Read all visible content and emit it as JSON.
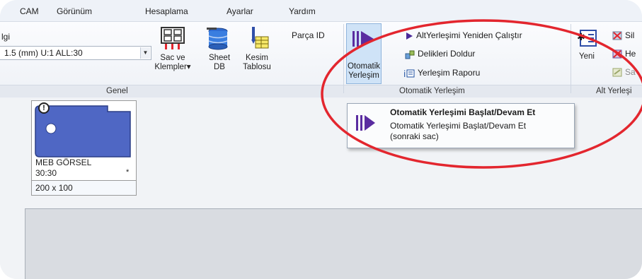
{
  "menu": {
    "items": [
      "CAM",
      "Görünüm",
      "Hesaplama",
      "Ayarlar",
      "Yardım"
    ]
  },
  "ribbon": {
    "genel": {
      "cut_label": "lgi",
      "combo_value": "1.5 (mm)  U:1 ALL:30",
      "sac_klemp_line1": "Sac ve",
      "sac_klemp_line2": "Klempler",
      "sheet_db_line1": "Sheet",
      "sheet_db_line2": "DB",
      "kesim_line1": "Kesim",
      "kesim_line2": "Tablosu",
      "parca_id": "Parça ID",
      "group_label": "Genel"
    },
    "otomatik": {
      "button_line1": "Otomatik",
      "button_line2": "Yerleşim",
      "cmd_restart": "AltYerleşimi Yeniden Çalıştır",
      "cmd_fill": "Delikleri Doldur",
      "cmd_report": "Yerleşim Raporu",
      "group_label": "Otomatik Yerleşim"
    },
    "alt": {
      "new_label": "Yeni",
      "cmd_1": "Sil",
      "cmd_2": "He",
      "cmd_3": "Sa",
      "group_label": "Alt Yerleşi"
    }
  },
  "dropdown": {
    "title": "Otomatik Yerleşimi Başlat/Devam Et",
    "desc_line1": "Otomatik Yerleşimi Başlat/Devam Et",
    "desc_line2": "(sonraki sac)"
  },
  "part": {
    "name": "MEB GÖRSEL",
    "count": "30:30",
    "star": "*",
    "size": "200 x 100",
    "warning": "!"
  },
  "colors": {
    "part_fill": "#4f67c4",
    "accent_purple": "#5a2ca0",
    "highlight": "#e3262e"
  }
}
